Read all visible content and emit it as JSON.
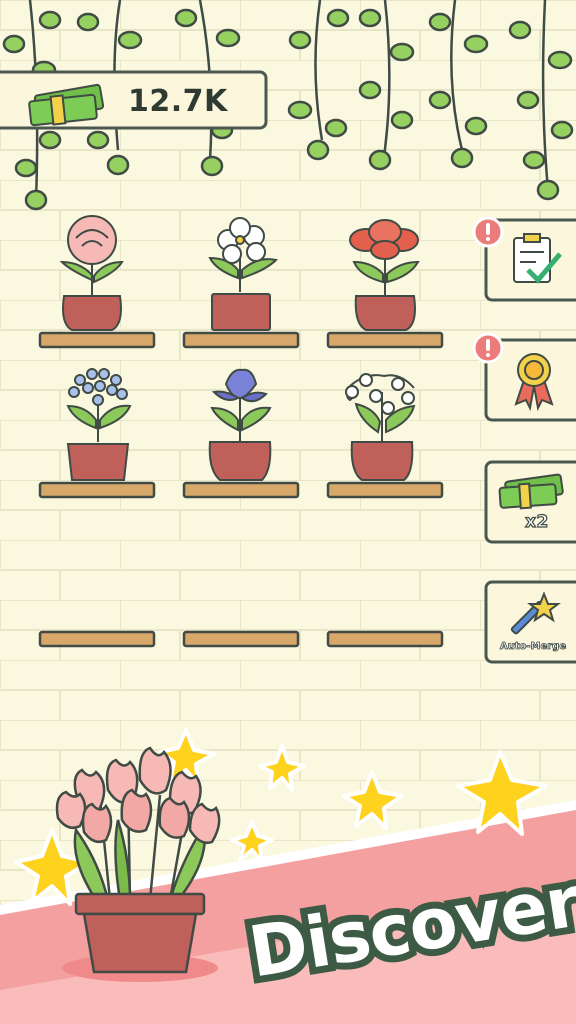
{
  "hud": {
    "money_value": "12.7K",
    "money_icon": "cash-stack-icon"
  },
  "side_buttons": [
    {
      "id": "tasks",
      "icon": "clipboard-check-icon",
      "alert": true,
      "label": ""
    },
    {
      "id": "achievements",
      "icon": "award-ribbon-icon",
      "alert": true,
      "label": ""
    },
    {
      "id": "double_income",
      "icon": "cash-stack-icon",
      "alert": false,
      "label": "x2"
    },
    {
      "id": "auto_merge",
      "icon": "magic-wand-icon",
      "alert": false,
      "label": "Auto-Merge"
    }
  ],
  "shelves": [
    {
      "row": 1,
      "plants": [
        "peony",
        "jasmine",
        "red-lily"
      ]
    },
    {
      "row": 2,
      "plants": [
        "agapanthus",
        "iris",
        "lily-of-the-valley"
      ]
    },
    {
      "row": 3,
      "plants": []
    }
  ],
  "banner": {
    "title": "Discover",
    "featured_plant": "tulip"
  },
  "colors": {
    "background": "#fbf8e0",
    "brick_line": "#e6e3c6",
    "vine_leaf": "#95d060",
    "pot": "#c0605a",
    "shelf": "#d8a86a",
    "banner_pink": "#f5a0a0",
    "banner_light": "#fcd3cf",
    "star": "#ffd21e",
    "outline": "#3f4b44",
    "alert": "#ec7b7b"
  }
}
